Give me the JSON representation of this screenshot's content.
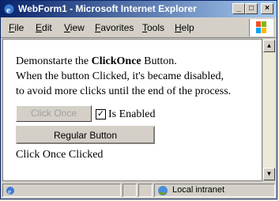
{
  "window": {
    "title": "WebForm1 - Microsoft Internet Explorer",
    "minimize_label": "_",
    "maximize_label": "□",
    "close_label": "×"
  },
  "menu": {
    "items": [
      {
        "label": "File",
        "u": "F",
        "rest": "ile"
      },
      {
        "label": "Edit",
        "u": "E",
        "rest": "dit"
      },
      {
        "label": "View",
        "u": "V",
        "rest": "iew"
      },
      {
        "label": "Favorites",
        "u": "F",
        "rest": "avorites"
      },
      {
        "label": "Tools",
        "u": "T",
        "rest": "ools"
      },
      {
        "label": "Help",
        "u": "H",
        "rest": "elp"
      }
    ]
  },
  "content": {
    "line1_prefix": "Demonstarte the ",
    "line1_bold": "ClickOnce",
    "line1_suffix": " Button.",
    "line2": "When the button Clicked, it's became disabled,",
    "line3": "to avoid more clicks until the end of the process.",
    "click_once_button": "Click Once",
    "checkbox_checked": true,
    "checkbox_mark": "✓",
    "checkbox_label": "Is Enabled",
    "regular_button": "Regular Button",
    "status_message": "Click Once Clicked"
  },
  "statusbar": {
    "zone": "Local intranet"
  },
  "colors": {
    "titlebar_start": "#0a246a",
    "titlebar_end": "#a6caf0"
  }
}
